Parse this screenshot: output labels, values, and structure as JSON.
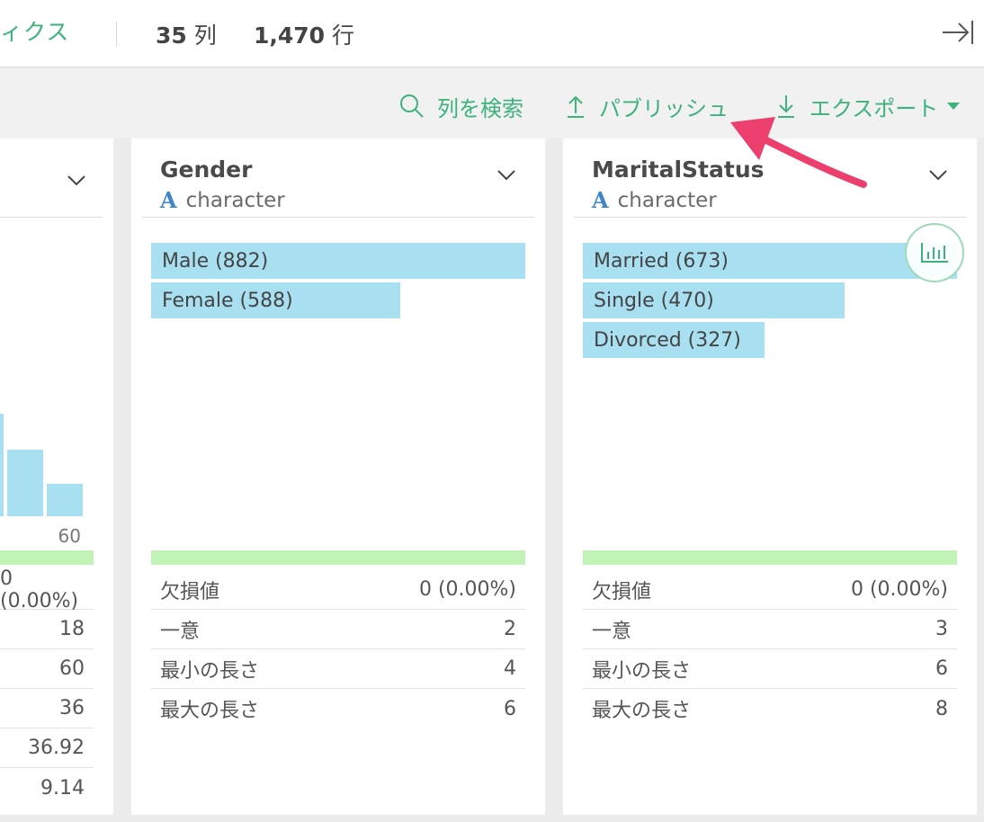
{
  "header": {
    "tab_partial": "ィクス",
    "col_count": "35",
    "col_unit": "列",
    "row_count": "1,470",
    "row_unit": "行"
  },
  "toolbar": {
    "search": "列を検索",
    "publish": "パブリッシュ",
    "export": "エクスポート"
  },
  "left_column": {
    "hist_values_note": "histogram partial",
    "tick_label": "60",
    "stats": [
      "0 (0.00%)",
      "18",
      "60",
      "36",
      "36.92",
      "9.14"
    ],
    "histogram": [
      0.75,
      0.49,
      0.24
    ]
  },
  "columns": [
    {
      "name": "Gender",
      "type": "character",
      "categories": [
        {
          "label": "Male (882)",
          "count": 882
        },
        {
          "label": "Female (588)",
          "count": 588
        }
      ],
      "stats": [
        {
          "label": "欠損値",
          "value": "0 (0.00%)"
        },
        {
          "label": "一意",
          "value": "2"
        },
        {
          "label": "最小の長さ",
          "value": "4"
        },
        {
          "label": "最大の長さ",
          "value": "6"
        }
      ]
    },
    {
      "name": "MaritalStatus",
      "type": "character",
      "categories": [
        {
          "label": "Married (673)",
          "count": 673
        },
        {
          "label": "Single (470)",
          "count": 470
        },
        {
          "label": "Divorced (327)",
          "count": 327
        }
      ],
      "stats": [
        {
          "label": "欠損値",
          "value": "0 (0.00%)"
        },
        {
          "label": "一意",
          "value": "3"
        },
        {
          "label": "最小の長さ",
          "value": "6"
        },
        {
          "label": "最大の長さ",
          "value": "8"
        }
      ]
    }
  ],
  "colors": {
    "accent": "#3db27a",
    "bar": "#a8e0f1",
    "valid": "#c1f2b6",
    "type_icon": "#3c86c9",
    "annotation_arrow": "#ec3f6d"
  }
}
